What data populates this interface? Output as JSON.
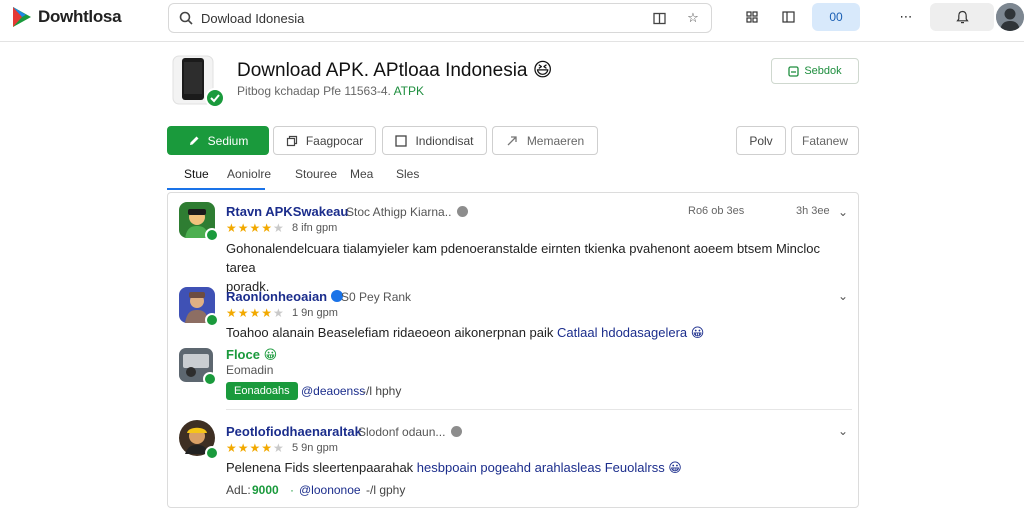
{
  "topbar": {
    "brand": "Dowhtlosa",
    "search_value": "Dowload Idonesia",
    "right_pill": "00"
  },
  "header": {
    "title": "Download APK. APtloaa Indonesia 😆",
    "subtitle_prefix": "Pitbog kchadap Pfe 11563-4.",
    "subtitle_version": "ATPK",
    "top_action_label": "Sebdok"
  },
  "toolbar": {
    "primary_label": "Sedium",
    "btn2_label": "Faagpocar",
    "btn3_label": "Indiondisat",
    "btn4_label": "Memaeren",
    "btn5_label": "Polv",
    "btn6_label": "Fatanew"
  },
  "tabs": [
    {
      "label": "Stue",
      "active": true
    },
    {
      "label": "Aoniolre",
      "active": false
    },
    {
      "label": "Stouree",
      "active": false
    },
    {
      "label": "Mea",
      "active": false
    },
    {
      "label": "Sles",
      "active": false
    }
  ],
  "feed": {
    "posts": [
      {
        "name": "Rtavn APKSwakeau",
        "meta": "Stoc Athigp Kiarna..",
        "rating": 4,
        "meta2": "8 ifn gpm",
        "time_a": "Ro6 ob 3es",
        "time_b": "3h 3ee",
        "body": "Gohonalendelcuara tialamyieler kam pdenoeranstalde eirnten tkienka pvahenont aoeem btsem Mincloc tarea ",
        "body_tail": "poradk."
      },
      {
        "name": "Raonlonheoaian",
        "meta": "S0 Pey Rank",
        "rating": 4,
        "meta2": "1 9n gpm",
        "body": "Toahoo alanain Beaselefiam ridaeoeon aikonerpnan paik ",
        "body_hl": "Catlaal hdodasagelera 😀",
        "reply_name": "Floce 😀",
        "reply_sub": "Eomadin",
        "tag": "Eonadoahs",
        "link": "@deaoenss",
        "link_sep": "·",
        "tail": "-/l hphy"
      },
      {
        "name": "Peotlofiodhaenaraltak",
        "meta": "Slodonf odaun...",
        "rating": 4,
        "meta2": "5 9n gpm",
        "body": "Pelenena Fids sleertenpaarahak ",
        "body_hl": "hesbpoain pogeahd arahlasleas Feuolalrss 😀",
        "footer_label": "AdL:",
        "footer_value": "9000",
        "link": "@loononoe",
        "tail": "-/l gphy"
      }
    ]
  },
  "colors": {
    "accent_green": "#1a9a3c",
    "link_blue": "#1b2d8c",
    "star": "#f2a900"
  }
}
